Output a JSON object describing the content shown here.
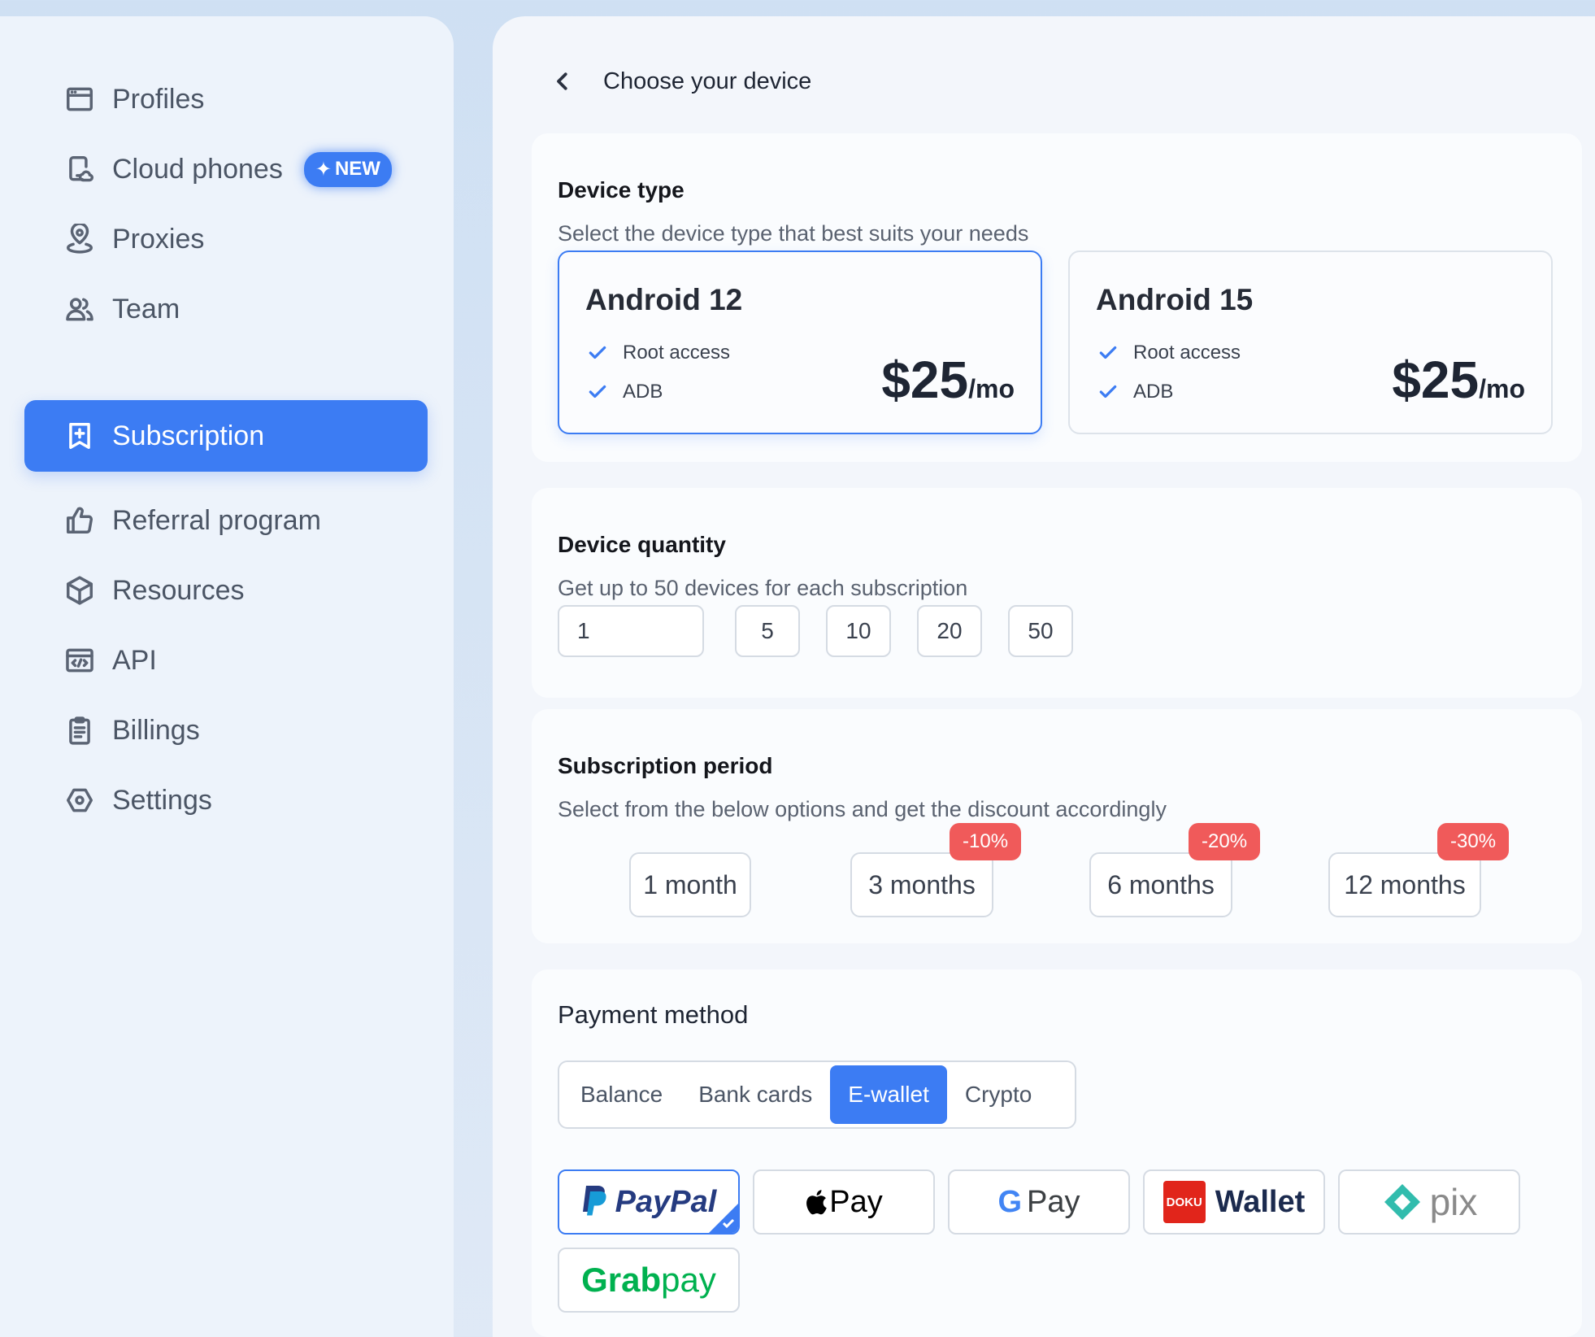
{
  "sidebar": {
    "items": [
      {
        "label": "Profiles",
        "icon": "browser-window-icon"
      },
      {
        "label": "Cloud phones",
        "icon": "cloud-phone-icon",
        "badge": "NEW"
      },
      {
        "label": "Proxies",
        "icon": "location-pin-icon"
      },
      {
        "label": "Team",
        "icon": "users-icon"
      },
      {
        "label": "Subscription",
        "icon": "bookmark-plus-icon",
        "active": true
      },
      {
        "label": "Referral program",
        "icon": "thumbs-up-icon"
      },
      {
        "label": "Resources",
        "icon": "cube-icon"
      },
      {
        "label": "API",
        "icon": "code-window-icon"
      },
      {
        "label": "Billings",
        "icon": "clipboard-list-icon"
      },
      {
        "label": "Settings",
        "icon": "settings-hexagon-icon"
      }
    ]
  },
  "header": {
    "title": "Choose your device"
  },
  "device_type": {
    "title": "Device type",
    "subtitle": "Select the device type that best suits your needs",
    "options": [
      {
        "name": "Android 12",
        "features": [
          "Root access",
          "ADB"
        ],
        "price": "$25",
        "per": "/mo",
        "selected": true
      },
      {
        "name": "Android 15",
        "features": [
          "Root access",
          "ADB"
        ],
        "price": "$25",
        "per": "/mo",
        "selected": false
      }
    ]
  },
  "quantity": {
    "title": "Device quantity",
    "subtitle": "Get up to 50 devices for each subscription",
    "value": "1",
    "presets": [
      "5",
      "10",
      "20",
      "50"
    ]
  },
  "period": {
    "title": "Subscription period",
    "subtitle": "Select from the below options and get the discount accordingly",
    "options": [
      {
        "label": "1 month",
        "discount": ""
      },
      {
        "label": "3 months",
        "discount": "-10%"
      },
      {
        "label": "6 months",
        "discount": "-20%"
      },
      {
        "label": "12 months",
        "discount": "-30%"
      }
    ]
  },
  "payment": {
    "title": "Payment method",
    "tabs": [
      "Balance",
      "Bank cards",
      "E-wallet",
      "Crypto"
    ],
    "active_tab": "E-wallet",
    "methods": [
      {
        "name": "PayPal",
        "selected": true
      },
      {
        "name": "Pay",
        "brand": "Apple"
      },
      {
        "name": "Pay",
        "brand": "Google"
      },
      {
        "name": "Wallet",
        "brand": "DOKU",
        "mark": "DOKU"
      },
      {
        "name": "pix"
      },
      {
        "name": "Grabpay",
        "parts": [
          "Grab",
          "pay"
        ]
      }
    ]
  },
  "colors": {
    "accent": "#3c7cf3",
    "discount": "#f05a5a"
  }
}
